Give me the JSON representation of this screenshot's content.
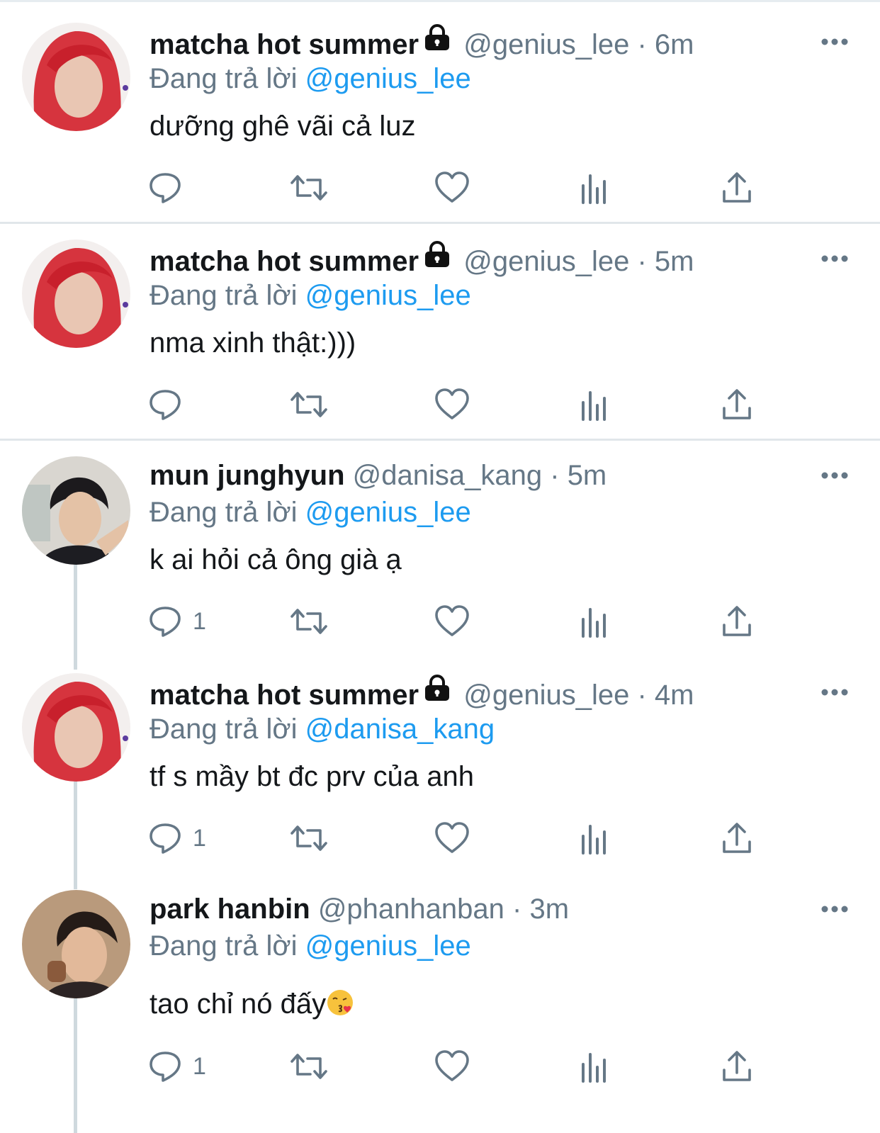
{
  "tweets": [
    {
      "display_name": "matcha hot summer",
      "locked": true,
      "handle": "@genius_lee",
      "separator": "·",
      "time": "6m",
      "reply_prefix": "Đang trả lời",
      "reply_to": "@genius_lee",
      "text": "dưỡng ghê vãi cả luz",
      "reply_count": "",
      "avatar": "red-hair-avatar"
    },
    {
      "display_name": "matcha hot summer",
      "locked": true,
      "handle": "@genius_lee",
      "separator": "·",
      "time": "5m",
      "reply_prefix": "Đang trả lời",
      "reply_to": "@genius_lee",
      "text": "nma xinh thật:)))",
      "reply_count": "",
      "avatar": "red-hair-avatar"
    },
    {
      "display_name": "mun junghyun",
      "locked": false,
      "handle": "@danisa_kang",
      "separator": "·",
      "time": "5m",
      "reply_prefix": "Đang trả lời",
      "reply_to": "@genius_lee",
      "text": "k ai hỏi cả ông già ạ",
      "reply_count": "1",
      "avatar": "dark-hair-avatar"
    },
    {
      "display_name": "matcha hot summer",
      "locked": true,
      "handle": "@genius_lee",
      "separator": "·",
      "time": "4m",
      "reply_prefix": "Đang trả lời",
      "reply_to": "@danisa_kang",
      "text": "tf s mầy bt đc prv của anh",
      "reply_count": "1",
      "avatar": "red-hair-avatar"
    },
    {
      "display_name": "park hanbin",
      "locked": false,
      "handle": "@phanhanban",
      "separator": "·",
      "time": "3m",
      "reply_prefix": "Đang trả lời",
      "reply_to": "@genius_lee",
      "text": "tao chỉ nó đấy",
      "text_emoji": "kissing-face-emoji",
      "reply_count": "1",
      "avatar": "dark-hair-avatar"
    }
  ],
  "icons": {
    "reply": "reply-icon",
    "retweet": "retweet-icon",
    "like": "heart-icon",
    "analytics": "analytics-icon",
    "share": "share-icon",
    "more": "more-icon",
    "lock": "lock-icon"
  },
  "colors": {
    "mention": "#1d9bf0",
    "secondary_text": "#657786",
    "primary_text": "#14171a",
    "icon": "#657786"
  }
}
